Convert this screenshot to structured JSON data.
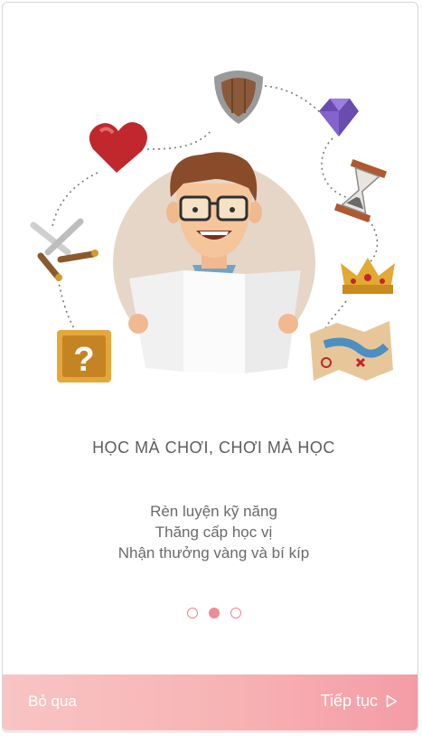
{
  "onboarding": {
    "title": "HỌC MÀ CHƠI, CHƠI MÀ HỌC",
    "subtitles": [
      "Rèn luyện kỹ năng",
      "Thăng cấp học vị",
      "Nhận thưởng vàng và bí kíp"
    ],
    "pagination": {
      "current": 2,
      "total": 3
    }
  },
  "footer": {
    "skip_label": "Bỏ qua",
    "next_label": "Tiếp tục",
    "next_icon": "play-outline-icon"
  },
  "illustration_icons": [
    "shield-icon",
    "heart-icon",
    "diamond-icon",
    "hourglass-icon",
    "swords-icon",
    "crown-icon",
    "question-box-icon",
    "treasure-map-icon",
    "student-avatar"
  ],
  "colors": {
    "accent": "#f49ca6",
    "text": "#5e5e5e"
  }
}
